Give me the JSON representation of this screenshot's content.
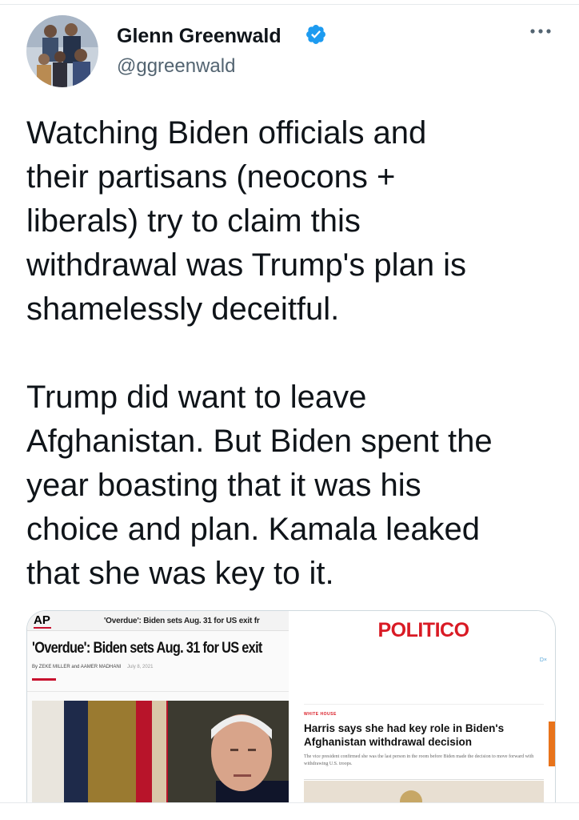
{
  "author": {
    "name": "Glenn Greenwald",
    "handle": "@ggreenwald",
    "verified": true,
    "icons": [
      "avatar",
      "verified-badge-icon",
      "more-options-icon"
    ]
  },
  "tweet": {
    "paragraph1": [
      "Watching Biden officials and",
      "their partisans (neocons +",
      "liberals) try to claim this",
      "withdrawal was Trump's plan is",
      "shamelessly deceitful."
    ],
    "paragraph2": [
      "Trump did want to leave",
      "Afghanistan. But Biden spent the",
      "year boasting that it was his",
      "choice and plan. Kamala leaked",
      "that she was key to it."
    ]
  },
  "media": {
    "ap": {
      "logo": "AP",
      "small_title": "'Overdue': Biden sets Aug. 31 for US exit fr",
      "headline": "'Overdue': Biden sets Aug. 31 for US exit",
      "byline": "By ZEKE MILLER and AAMER MADHANI",
      "date": "July 8, 2021"
    },
    "politico": {
      "logo": "POLITICO",
      "ad_marker": "D×",
      "kicker": "WHITE HOUSE",
      "headline": "Harris says she had key role in Biden's Afghanistan withdrawal decision",
      "dek": "The vice president confirmed she was the last person in the room before Biden made the decision to move forward with withdrawing U.S. troops."
    }
  },
  "colors": {
    "text": "#0f1419",
    "secondary": "#536471",
    "verified": "#1d9bf0",
    "politico_red": "#d91a24",
    "ap_red": "#c8102e"
  }
}
